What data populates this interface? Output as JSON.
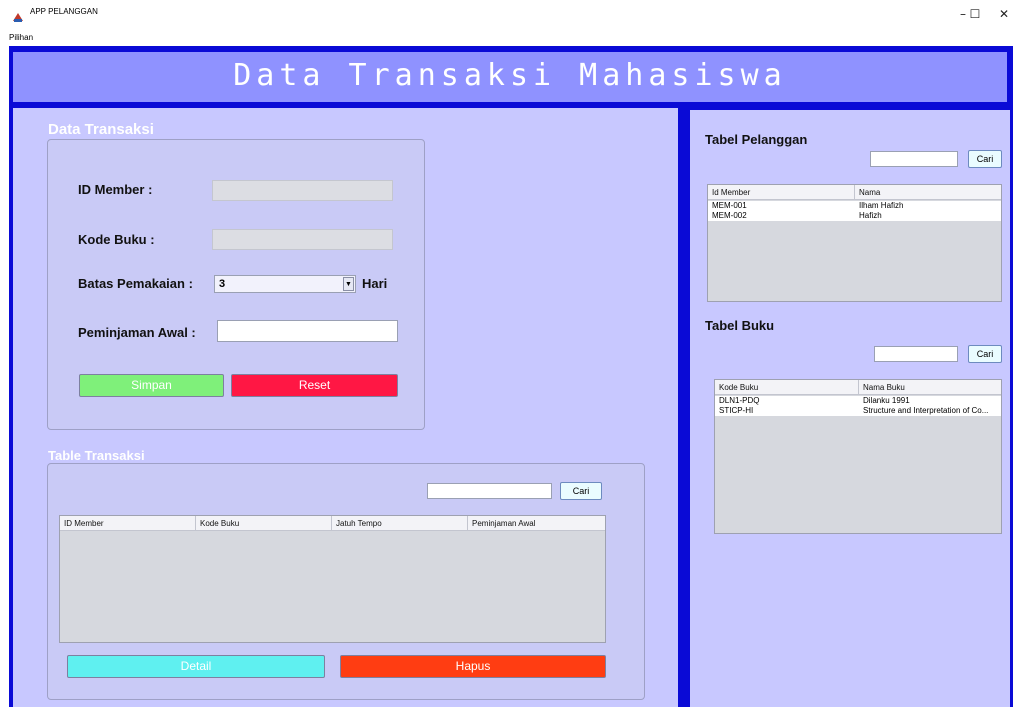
{
  "window": {
    "title": "APP PELANGGAN",
    "minimize": "–",
    "maximize": "☐",
    "close": "✕"
  },
  "menu": {
    "items": [
      "Pilihan"
    ]
  },
  "header": {
    "title": "Data Transaksi Mahasiswa"
  },
  "form": {
    "section_title": "Data Transaksi",
    "id_member_label": "ID Member :",
    "id_member_value": "",
    "kode_buku_label": "Kode Buku :",
    "kode_buku_value": "",
    "batas_label": "Batas Pemakaian :",
    "batas_value": "3",
    "batas_unit": "Hari",
    "awal_label": "Peminjaman Awal :",
    "awal_value": "",
    "simpan": "Simpan",
    "reset": "Reset"
  },
  "transaksi_table": {
    "section_title": "Table Transaksi",
    "search_value": "",
    "search_button": "Cari",
    "columns": [
      "ID Member",
      "Kode Buku",
      "Jatuh Tempo",
      "Peminjaman Awal"
    ],
    "rows": [],
    "detail": "Detail",
    "hapus": "Hapus"
  },
  "pelanggan_table": {
    "title": "Tabel Pelanggan",
    "search_value": "",
    "search_button": "Cari",
    "columns": [
      "Id Member",
      "Nama"
    ],
    "rows": [
      [
        "MEM-001",
        "Ilham Hafizh"
      ],
      [
        "MEM-002",
        "Hafizh"
      ]
    ]
  },
  "buku_table": {
    "title": "Tabel Buku",
    "search_value": "",
    "search_button": "Cari",
    "columns": [
      "Kode Buku",
      "Nama Buku"
    ],
    "rows": [
      [
        "DLN1-PDQ",
        "Dilanku 1991"
      ],
      [
        "STICP-HI",
        "Structure and Interpretation of Co..."
      ]
    ]
  },
  "colors": {
    "frame": "#0a0ad6",
    "header": "#8f92ff",
    "panel": "#c8c8ff",
    "simpan": "#7ff07a",
    "reset": "#ff1744",
    "detail": "#5ff0f0",
    "hapus": "#ff3d12"
  }
}
